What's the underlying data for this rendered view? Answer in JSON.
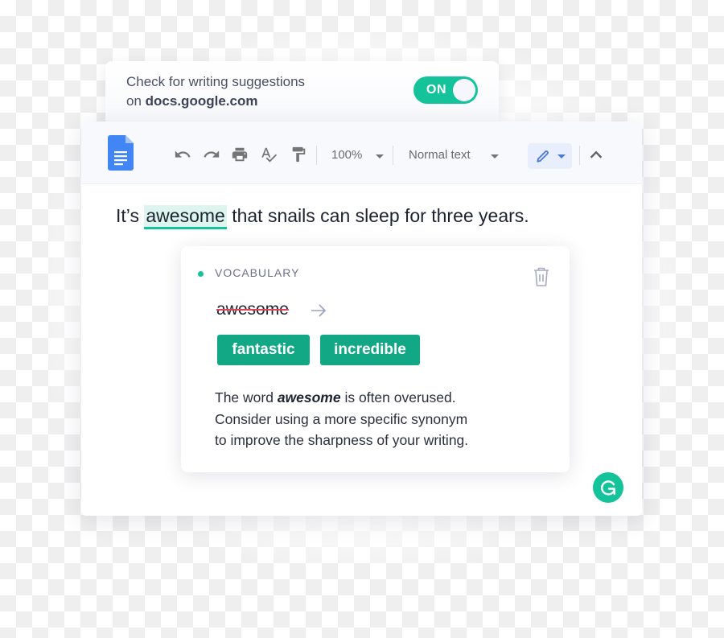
{
  "settings": {
    "line1": "Check for writing suggestions",
    "line2_prefix": "on",
    "line2_domain": "docs.google.com",
    "toggle_label": "ON",
    "toggle_state": "on"
  },
  "toolbar": {
    "app_icon": "google-docs-icon",
    "icons": [
      "undo-icon",
      "redo-icon",
      "print-icon",
      "spellcheck-icon",
      "paint-format-icon"
    ],
    "zoom_value": "100%",
    "style_value": "Normal text",
    "mode_icon": "pencil-icon",
    "collapse_icon": "chevron-up-icon"
  },
  "document": {
    "before": "It’s ",
    "highlighted_word": "awesome",
    "after": " that snails can sleep for three years."
  },
  "suggestion": {
    "category": "VOCABULARY",
    "original_word": "awesome",
    "replacements": [
      "fantastic",
      "incredible"
    ],
    "explanation_pre": "The word ",
    "explanation_word": "awesome",
    "explanation_line1_post": " is often overused.",
    "explanation_line2": "Consider using a more specific synonym",
    "explanation_line3": "to improve the sharpness of your writing."
  },
  "colors": {
    "accent": "#15c39a",
    "chip": "#13a885",
    "strike": "#e0455a",
    "docs_blue": "#4285f4"
  }
}
